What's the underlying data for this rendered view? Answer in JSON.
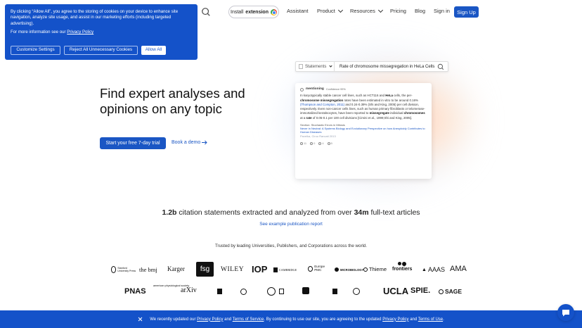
{
  "cookie": {
    "text1": "By clicking “Allow All”, you agree to the storing of cookies on your device to enhance site navigation, analyze site usage, and assist in our marketing efforts (including targeted advertising).",
    "text2_prefix": "For more information see our ",
    "privacy_link": "Privacy Policy",
    "customize": "Customize Settings",
    "reject": "Reject All Unnecessary Cookies",
    "allow": "Allow All"
  },
  "nav": {
    "install_pre": "Install ",
    "install_strong": "extension",
    "assistant": "Assistant",
    "product": "Product",
    "resources": "Resources",
    "pricing": "Pricing",
    "blog": "Blog",
    "signin": "Sign in",
    "signup": "Sign Up"
  },
  "hero": {
    "title": "Find expert analyses and opinions on any topic",
    "cta": "Start your free 7-day trial",
    "demo": "Book a demo"
  },
  "card": {
    "search_type": "Statements",
    "query": "Rate of chromosome missegregation in HeLa Cells",
    "mentioning": "mentioning",
    "confidence": "Confidence 99%",
    "body_1": "In karyotypically stable cancer cell lines, such as HCT116 and ",
    "hela": "HeLa",
    "body_2": " cells, the per-",
    "chrom_mis": "chromosome missegregation",
    "body_3": " rates have been estimated in vitro to be around 0.16% ",
    "cite1": "(Thompson and Compton, 2011)",
    "body_4": " and 0.24-0.39% (Shi and King, 2005) per cell division, respectively. Even non-cancer cells lines, such as human primary fibroblasts or telomerase-immortalized keratinocytes, have been reported to ",
    "misseg": "missegregate",
    "body_5": " individual ",
    "chromosomes": "chromosomes",
    "body_6": " at a ",
    "rate": "rate",
    "body_7": " of 0.05-0.1 per 100 cell divisions [Cimini et al., 1999;Shi and King, 2005].",
    "section": "Section: Stochastic Errors in Mitosis",
    "paper_title": "Never in Neutral: A Systems Biology and Evolutionary Perspective on how Aneuploidy Contributes to Human Diseases",
    "paper_meta": "Pavelka, Cirou Rancati 2013",
    "f1": "11",
    "f2": "0",
    "f3": "4",
    "f4": "5"
  },
  "stats": {
    "n1": "1.2b",
    "t1": " citation statements extracted and analyzed from over ",
    "n2": "34m",
    "t2": " full-text articles",
    "report": "See example publication report",
    "trusted": "Trusted by leading Universities, Publishers, and Corporations across the world."
  },
  "logos": {
    "stanford": "Stanford University Press",
    "bmj": "the bmj",
    "karger": "Karger",
    "fsg": "fsg",
    "wiley": "WILEY",
    "iop": "IOP",
    "cambridge": "CAMBRIDGE",
    "europepmc": "Europe PMC",
    "microbiology": "MICROBIOLOGY",
    "thieme": "Thieme",
    "frontiers": "frontiers",
    "aaas": "AAAS",
    "ama": "AMA",
    "pnas": "PNAS",
    "aps": "american physiological society",
    "arxiv": "arXiv",
    "ucla": "UCLA",
    "spie": "SPIE.",
    "sage": "SAGE"
  },
  "bottom": {
    "prefix": "We recently updated our ",
    "privacy": "Privacy Policy",
    "and": " and ",
    "terms": "Terms of Service",
    "middle": ". By continuing to use our site, you are agreeing to the updated ",
    "privacy2": "Privacy Policy",
    "and2": " and ",
    "terms2": "Terms of Use",
    "end": "."
  }
}
